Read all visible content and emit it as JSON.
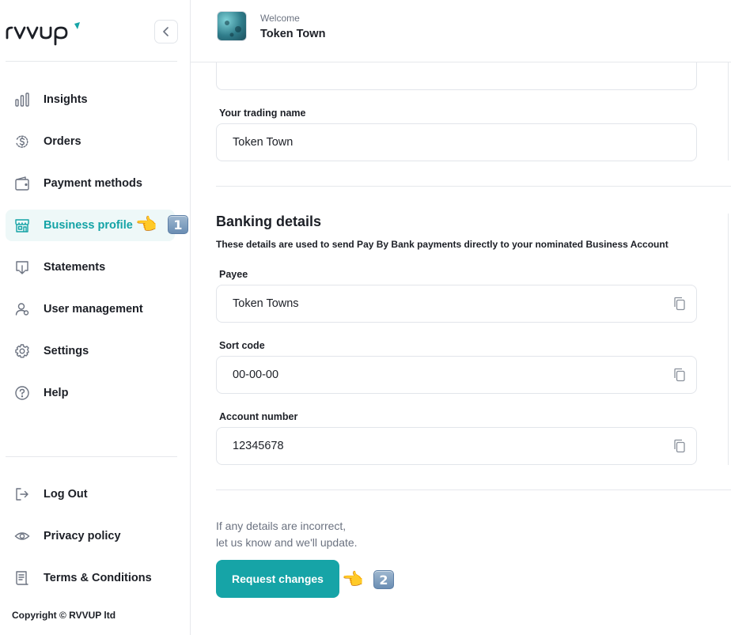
{
  "brand": {
    "logo_text": "rvvup",
    "accent": "#16a4a7"
  },
  "sidebar": {
    "items": [
      {
        "label": "Insights",
        "icon": "bar-chart-icon"
      },
      {
        "label": "Orders",
        "icon": "dollar-refresh-icon"
      },
      {
        "label": "Payment methods",
        "icon": "wallet-icon"
      },
      {
        "label": "Business profile",
        "icon": "storefront-icon",
        "active": true
      },
      {
        "label": "Statements",
        "icon": "statement-download-icon"
      },
      {
        "label": "User management",
        "icon": "users-icon"
      },
      {
        "label": "Settings",
        "icon": "gear-icon"
      },
      {
        "label": "Help",
        "icon": "help-circle-icon"
      }
    ],
    "footer_items": [
      {
        "label": "Log Out",
        "icon": "logout-icon"
      },
      {
        "label": "Privacy policy",
        "icon": "eye-icon"
      },
      {
        "label": "Terms & Conditions",
        "icon": "document-icon"
      }
    ],
    "copyright": "Copyright © RVVUP ltd"
  },
  "header": {
    "welcome": "Welcome",
    "company": "Token Town"
  },
  "form": {
    "trading_name": {
      "label": "Your trading name",
      "value": "Token Town"
    }
  },
  "banking": {
    "title": "Banking details",
    "description": "These details are used to send Pay By Bank payments directly to your nominated Business Account",
    "payee": {
      "label": "Payee",
      "value": "Token Towns"
    },
    "sort_code": {
      "label": "Sort code",
      "value": "00-00-00"
    },
    "account_number": {
      "label": "Account number",
      "value": "12345678"
    }
  },
  "note": {
    "line1": "If any details are incorrect,",
    "line2": "let us know and we'll update."
  },
  "actions": {
    "request_changes": "Request changes"
  },
  "annotations": {
    "step1": "1",
    "step2": "2"
  }
}
